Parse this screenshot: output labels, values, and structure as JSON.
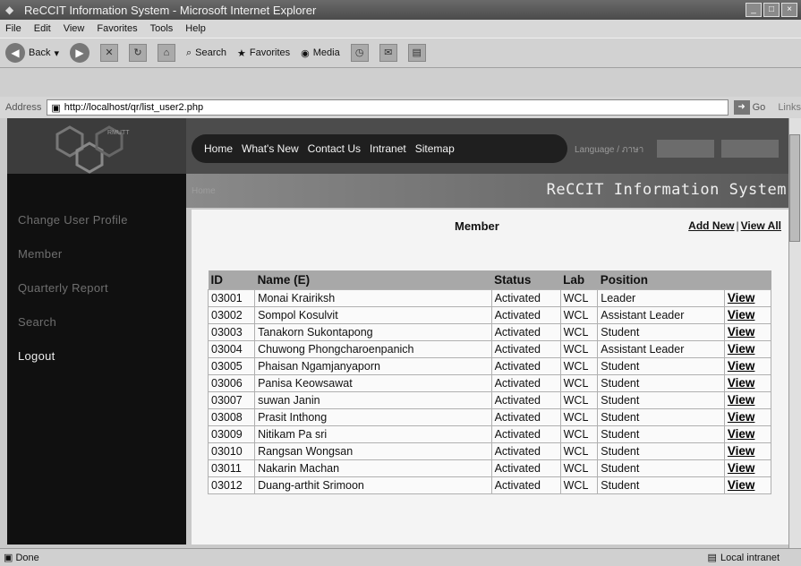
{
  "window": {
    "title": "ReCCIT Information System - Microsoft Internet Explorer",
    "minimize": "_",
    "maximize": "□",
    "close": "×"
  },
  "menu": [
    "File",
    "Edit",
    "View",
    "Favorites",
    "Tools",
    "Help"
  ],
  "toolbar": {
    "back": "Back",
    "search": "Search",
    "favorites": "Favorites",
    "media": "Media"
  },
  "address": {
    "label": "Address",
    "url": "http://localhost/qr/list_user2.php",
    "go": "Go",
    "links": "Links"
  },
  "site": {
    "logo_text": "RMUTT",
    "top_nav": [
      "Home",
      "What's New",
      "Contact Us",
      "Intranet",
      "Sitemap"
    ],
    "language": "Language / ภาษา",
    "crumb": "Home",
    "system_title": "ReCCIT Information System",
    "side_nav": [
      "Change User Profile",
      "Member",
      "Quarterly Report",
      "Search",
      "Logout"
    ]
  },
  "member": {
    "title": "Member",
    "add_new": "Add New",
    "separator": "|",
    "view_all": "View All",
    "columns": [
      "ID",
      "Name (E)",
      "Status",
      "Lab",
      "Position"
    ],
    "view_label": "View",
    "rows": [
      {
        "id": "03001",
        "name": "Monai Krairiksh",
        "status": "Activated",
        "lab": "WCL",
        "position": "Leader"
      },
      {
        "id": "03002",
        "name": "Sompol Kosulvit",
        "status": "Activated",
        "lab": "WCL",
        "position": "Assistant Leader"
      },
      {
        "id": "03003",
        "name": "Tanakorn Sukontapong",
        "status": "Activated",
        "lab": "WCL",
        "position": "Student"
      },
      {
        "id": "03004",
        "name": "Chuwong Phongcharoenpanich",
        "status": "Activated",
        "lab": "WCL",
        "position": "Assistant Leader"
      },
      {
        "id": "03005",
        "name": "Phaisan Ngamjanyaporn",
        "status": "Activated",
        "lab": "WCL",
        "position": "Student"
      },
      {
        "id": "03006",
        "name": "Panisa Keowsawat",
        "status": "Activated",
        "lab": "WCL",
        "position": "Student"
      },
      {
        "id": "03007",
        "name": "suwan Janin",
        "status": "Activated",
        "lab": "WCL",
        "position": "Student"
      },
      {
        "id": "03008",
        "name": "Prasit Inthong",
        "status": "Activated",
        "lab": "WCL",
        "position": "Student"
      },
      {
        "id": "03009",
        "name": "Nitikam Pa sri",
        "status": "Activated",
        "lab": "WCL",
        "position": "Student"
      },
      {
        "id": "03010",
        "name": "Rangsan Wongsan",
        "status": "Activated",
        "lab": "WCL",
        "position": "Student"
      },
      {
        "id": "03011",
        "name": "Nakarin Machan",
        "status": "Activated",
        "lab": "WCL",
        "position": "Student"
      },
      {
        "id": "03012",
        "name": "Duang-arthit Srimoon",
        "status": "Activated",
        "lab": "WCL",
        "position": "Student"
      }
    ]
  },
  "status": {
    "left": "Done",
    "zone": "Local intranet"
  }
}
